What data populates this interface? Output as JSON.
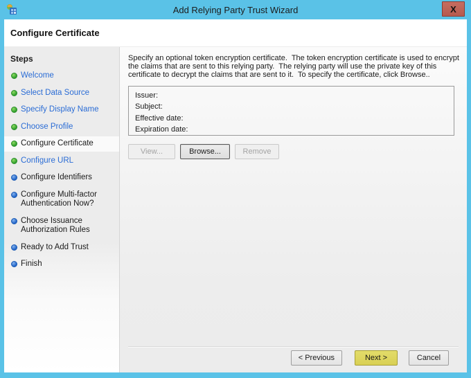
{
  "window": {
    "title": "Add Relying Party Trust Wizard",
    "close_glyph": "X",
    "page_title": "Configure Certificate"
  },
  "sidebar": {
    "header": "Steps",
    "items": [
      {
        "label": "Welcome",
        "status": "completed",
        "style": "link"
      },
      {
        "label": "Select Data Source",
        "status": "completed",
        "style": "link"
      },
      {
        "label": "Specify Display Name",
        "status": "completed",
        "style": "link"
      },
      {
        "label": "Choose Profile",
        "status": "completed",
        "style": "link"
      },
      {
        "label": "Configure Certificate",
        "status": "completed",
        "style": "current"
      },
      {
        "label": "Configure URL",
        "status": "completed",
        "style": "link"
      },
      {
        "label": "Configure Identifiers",
        "status": "pending",
        "style": "plain"
      },
      {
        "label": "Configure Multi-factor Authentication Now?",
        "status": "pending",
        "style": "plain"
      },
      {
        "label": "Choose Issuance Authorization Rules",
        "status": "pending",
        "style": "plain"
      },
      {
        "label": "Ready to Add Trust",
        "status": "pending",
        "style": "plain"
      },
      {
        "label": "Finish",
        "status": "pending",
        "style": "plain"
      }
    ]
  },
  "main": {
    "description": "Specify an optional token encryption certificate.  The token encryption certificate is used to encrypt the claims that are sent to this relying party.  The relying party will use the private key of this certificate to decrypt the claims that are sent to it.  To specify the certificate, click Browse..",
    "certificate": {
      "fields": [
        "Issuer:",
        "Subject:",
        "Effective date:",
        "Expiration date:"
      ],
      "buttons": [
        {
          "label": "View...",
          "enabled": false
        },
        {
          "label": "Browse...",
          "enabled": true
        },
        {
          "label": "Remove",
          "enabled": false
        }
      ]
    }
  },
  "footer": {
    "previous_label": "< Previous",
    "next_label": "Next >",
    "cancel_label": "Cancel"
  },
  "colors": {
    "titlebar": "#5ac2e7",
    "close_button": "#c0615a",
    "link": "#2a6cd5",
    "bullet_completed": "#3aaa35",
    "bullet_pending": "#2f74d0",
    "next_button_highlight": "#ded75f"
  }
}
